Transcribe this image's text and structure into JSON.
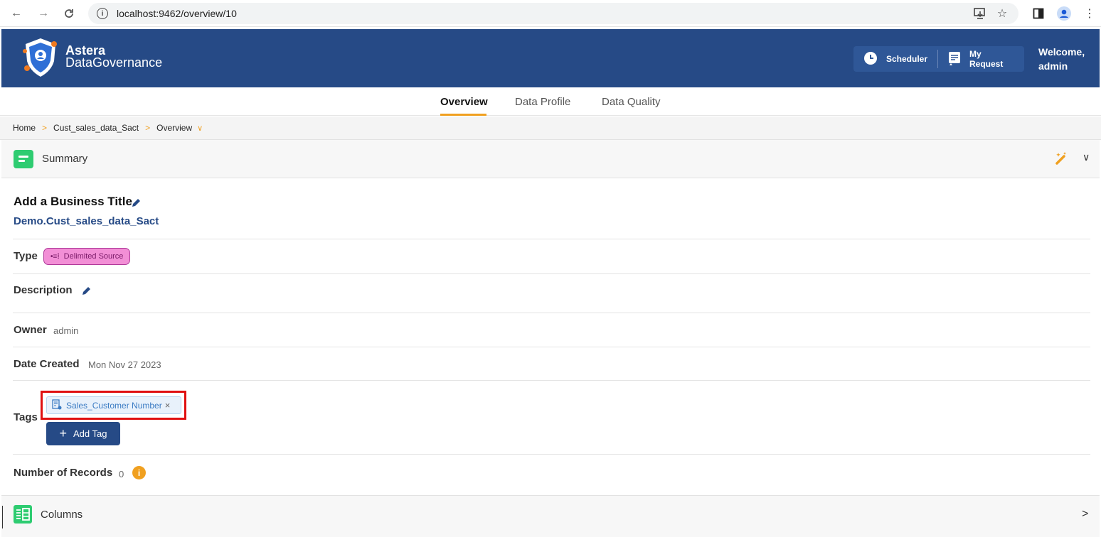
{
  "browser": {
    "back": "←",
    "forward": "→",
    "reload": "C",
    "url": "localhost:9462/overview/10"
  },
  "header": {
    "brand_line1": "Astera",
    "brand_line2": "DataGovernance",
    "scheduler_label": "Scheduler",
    "my_request_label": "My Request",
    "welcome_line1": "Welcome,",
    "welcome_line2": "admin"
  },
  "tabs": [
    {
      "label": "Overview",
      "active": true
    },
    {
      "label": "Data Profile",
      "active": false
    },
    {
      "label": "Data Quality",
      "active": false
    }
  ],
  "breadcrumb": [
    "Home",
    "Cust_sales_data_Sact",
    "Overview"
  ],
  "summary": {
    "title": "Summary",
    "business_title": "Add a Business Title",
    "fqn": "Demo.Cust_sales_data_Sact",
    "type_label": "Type",
    "type_value": "Delimited Source",
    "description_label": "Description",
    "owner_label": "Owner",
    "owner_value": "admin",
    "date_created_label": "Date Created",
    "date_created_value": "Mon Nov 27 2023",
    "tags_label": "Tags",
    "tag_value": "Sales_Customer Number",
    "add_tag_label": "Add Tag",
    "records_label": "Number of Records",
    "records_value": "0"
  },
  "columns": {
    "title": "Columns"
  },
  "colors": {
    "brand": "#264a86",
    "accent": "#f0a020",
    "section_icon": "#2ecc71",
    "highlight": "#e01010"
  }
}
